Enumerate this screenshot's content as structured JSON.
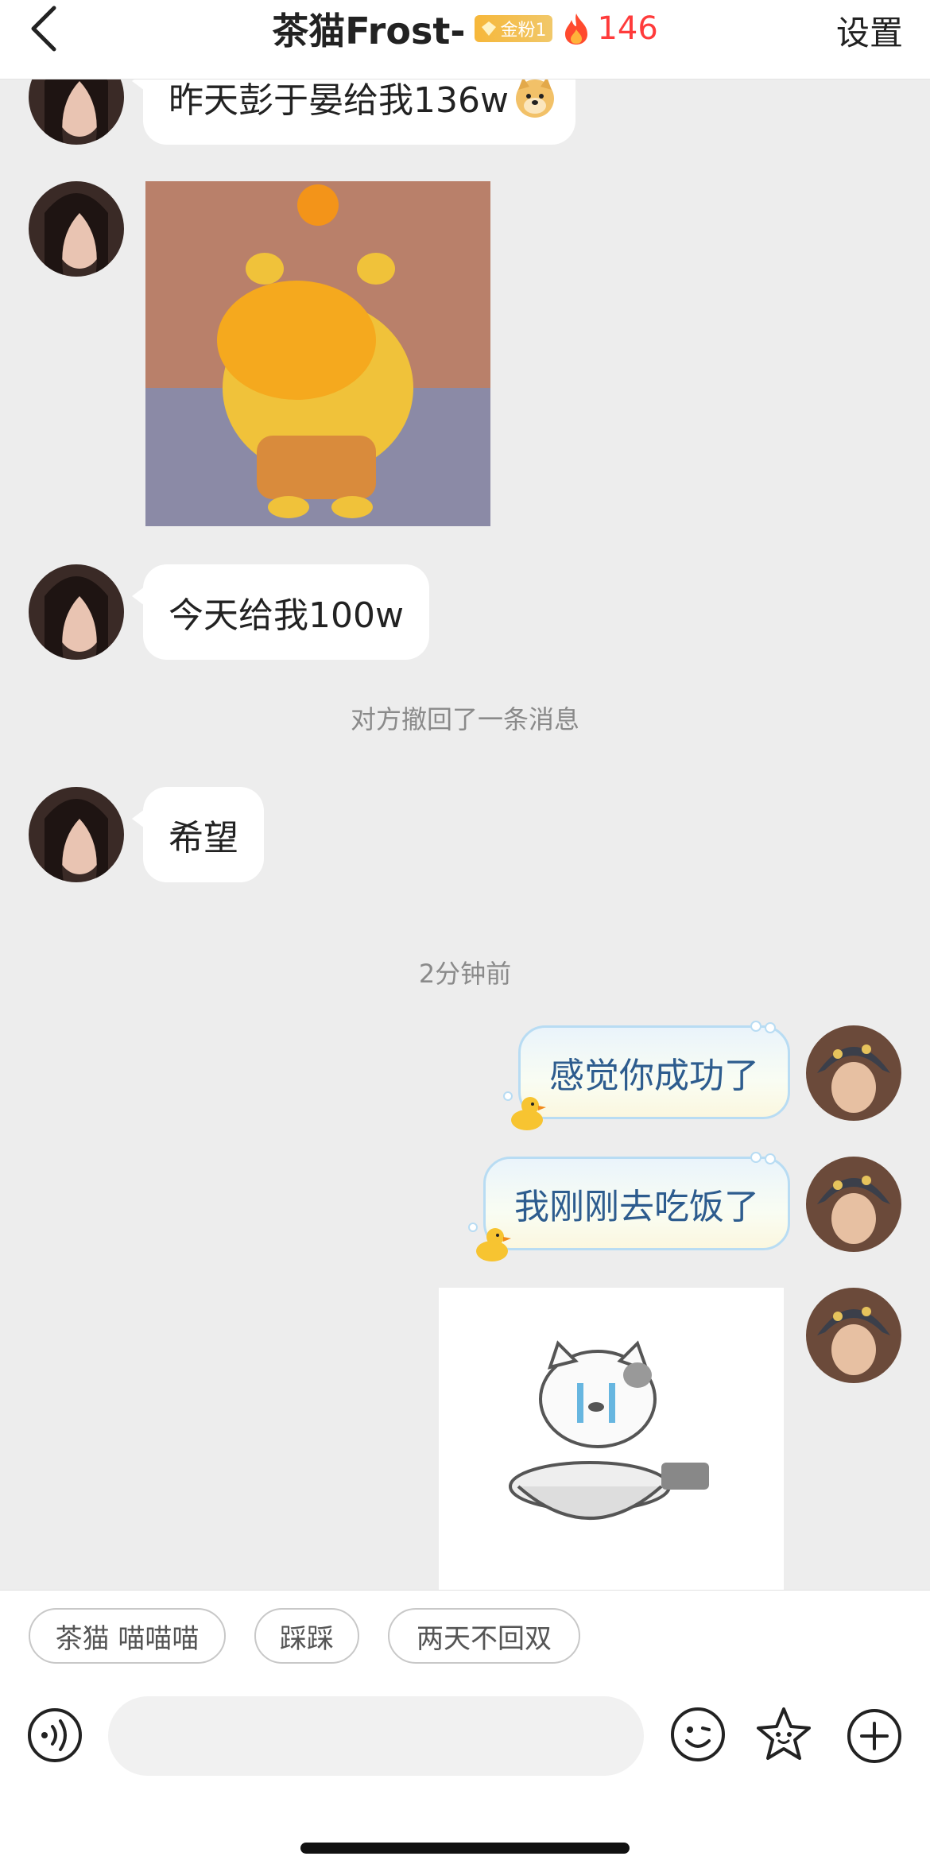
{
  "header": {
    "title": "茶猫Frost-",
    "fan_badge": "金粉1",
    "fire_count": "146",
    "settings_label": "设置"
  },
  "messages": {
    "m1_text": "昨天彭于晏给我136w",
    "m3_text": "今天给我100w",
    "recall_notice": "对方撤回了一条消息",
    "m4_text": "希望",
    "timestamp": "2分钟前",
    "m5_text": "感觉你成功了",
    "m6_text": "我刚刚去吃饭了"
  },
  "quick_replies": [
    "茶猫 喵喵喵",
    "踩踩",
    "两天不回双"
  ],
  "input": {
    "placeholder": ""
  },
  "colors": {
    "accent_fire": "#ff3b3b",
    "badge_gold": "#f6b73a",
    "bubble_border": "#b8dcf3",
    "bubble_text": "#2d5c8e"
  },
  "icons": [
    "chevron-left-icon",
    "gem-icon",
    "fire-icon",
    "voice-icon",
    "emoji-icon",
    "sticker-star-icon",
    "plus-icon",
    "duck-icon",
    "doge-emoji-icon"
  ]
}
